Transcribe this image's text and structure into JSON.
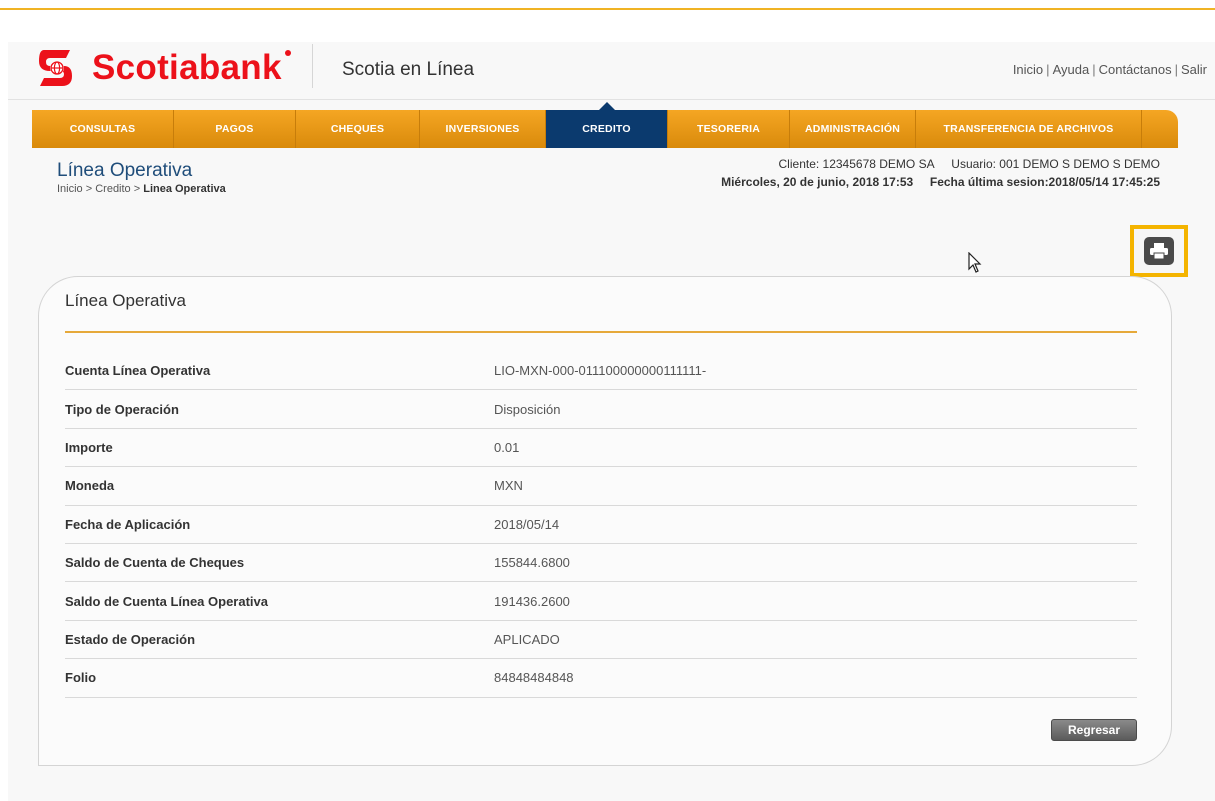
{
  "header": {
    "brand": "Scotiabank",
    "app_title": "Scotia en Línea",
    "links": [
      "Inicio",
      "Ayuda",
      "Contáctanos",
      "Salir"
    ]
  },
  "nav": {
    "items": [
      {
        "label": "CONSULTAS",
        "active": false
      },
      {
        "label": "PAGOS",
        "active": false
      },
      {
        "label": "CHEQUES",
        "active": false
      },
      {
        "label": "INVERSIONES",
        "active": false
      },
      {
        "label": "CREDITO",
        "active": true
      },
      {
        "label": "TESORERIA",
        "active": false
      },
      {
        "label": "ADMINISTRACIÓN",
        "active": false
      },
      {
        "label": "TRANSFERENCIA DE ARCHIVOS",
        "active": false
      }
    ]
  },
  "page": {
    "title": "Línea Operativa",
    "breadcrumb_prefix": "Inicio > Credito > ",
    "breadcrumb_current": "Linea Operativa"
  },
  "session": {
    "cliente": "Cliente: 12345678  DEMO SA",
    "usuario": "Usuario: 001 DEMO S DEMO S DEMO",
    "fecha": "Miércoles, 20 de junio, 2018 17:53",
    "ultima_sesion": "Fecha última sesion:2018/05/14 17:45:25"
  },
  "card": {
    "title": "Línea Operativa",
    "rows": [
      {
        "label": "Cuenta Línea Operativa",
        "value": "LIO-MXN-000-011100000000111111-"
      },
      {
        "label": "Tipo de Operación",
        "value": "Disposición"
      },
      {
        "label": "Importe",
        "value": "0.01"
      },
      {
        "label": "Moneda",
        "value": "MXN"
      },
      {
        "label": "Fecha de Aplicación",
        "value": "2018/05/14"
      },
      {
        "label": "Saldo de Cuenta de Cheques",
        "value": "155844.6800"
      },
      {
        "label": "Saldo de Cuenta Línea Operativa",
        "value": "191436.2600"
      },
      {
        "label": "Estado de Operación",
        "value": "APLICADO"
      },
      {
        "label": "Folio",
        "value": "84848484848"
      }
    ],
    "button_label": "Regresar"
  },
  "colors": {
    "brand_red": "#ec111a",
    "nav_orange": "#f5a623",
    "nav_active": "#0b3a6e",
    "highlight": "#f4b400"
  },
  "icons": {
    "print": "printer-icon",
    "cursor": "mouse-pointer-icon"
  }
}
